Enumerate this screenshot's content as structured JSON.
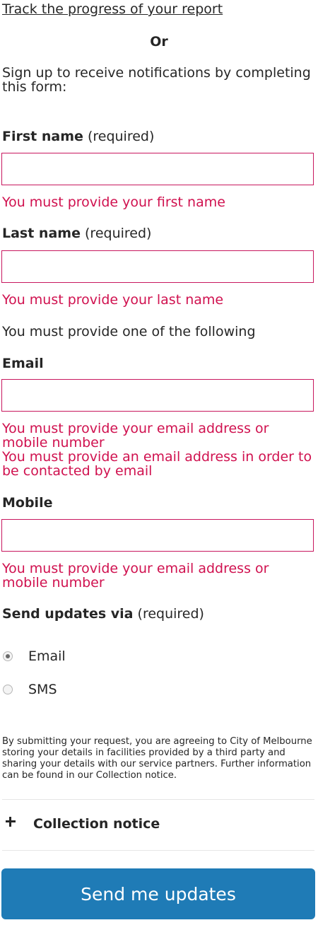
{
  "track_link": "Track the progress of your report",
  "or_text": "Or",
  "intro": "Sign up to receive notifications by completing this form:",
  "required_suffix": "(required)",
  "first_name": {
    "label": "First name",
    "value": "",
    "error": "You must provide your first name"
  },
  "last_name": {
    "label": "Last name",
    "value": "",
    "error": "You must provide your last name"
  },
  "one_of_following": "You must provide one of the following",
  "email": {
    "label": "Email",
    "value": "",
    "error_1": "You must provide your email address or mobile number",
    "error_2": "You must provide an email address in order to be contacted by email"
  },
  "mobile": {
    "label": "Mobile",
    "value": "",
    "error": "You must provide your email address or mobile number"
  },
  "send_updates": {
    "label": "Send updates via",
    "options": [
      {
        "label": "Email",
        "selected": true
      },
      {
        "label": "SMS",
        "selected": false
      }
    ]
  },
  "disclaimer": "By submitting your request, you are agreeing to City of Melbourne storing your details in facilities provided by a third party and sharing your details with our service partners. Further information can be found in our Collection notice.",
  "collection_notice": {
    "label": "Collection notice",
    "icon": "plus-icon"
  },
  "submit_label": "Send me updates",
  "colors": {
    "error": "#d0114f",
    "field_border": "#c8175e",
    "button": "#1f7bb6",
    "text": "#262626"
  }
}
